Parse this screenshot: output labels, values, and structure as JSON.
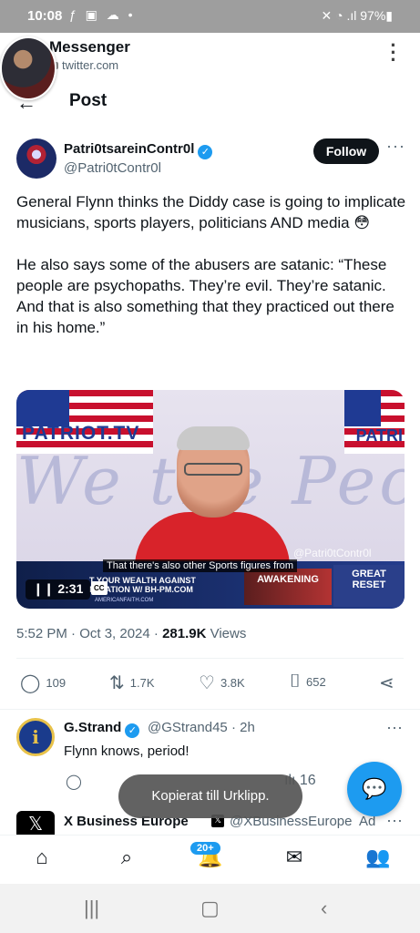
{
  "status_bar": {
    "time": "10:08",
    "left_icons": "ƒ ▣ ☁ •",
    "right": "✕ ◔ .ıl 97%▮"
  },
  "browser": {
    "title": "Messenger",
    "url": "twitter.com"
  },
  "page": {
    "back_icon": "←",
    "heading": "Post"
  },
  "tweet": {
    "author_name": "Patri0tsareinContr0l",
    "author_handle": "@Patri0tContr0l",
    "follow_label": "Follow",
    "text": "General Flynn thinks the Diddy case is going to implicate musicians, sports players, politicians AND media 😳\n\nHe also says some of the abusers are satanic: “These people are psychopaths. They’re evil. They’re satanic. And that is also something that they practiced out there in his home.”",
    "time": "5:52 PM · Oct 3, 2024 · ",
    "views_count": "281.9K",
    "views_label": " Views",
    "video": {
      "brand_left": "PATRIOT.TV",
      "brand_right": "PATRI",
      "background_script": "We the People",
      "caption": "That there's also other Sports figures from",
      "watermark": "@Patri0tContr0l",
      "ad_line1": "T YOUR WEALTH AGAINST",
      "ad_line2": "NFLATION W/ BH-PM.COM",
      "ad_line3": "AMERICANFAITH.COM",
      "awakening": "AWAKENING",
      "reset_line1": "GREAT",
      "reset_line2": "RESET",
      "duration": "2:31",
      "cc": "CC"
    },
    "actions": {
      "replies": "109",
      "reposts": "1.7K",
      "likes": "3.8K",
      "bookmarks": "652"
    }
  },
  "reply": {
    "name": "G.Strand",
    "handle": "@GStrand45 · 2h",
    "text": "Flynn knows, period!",
    "avatar_letter": "i",
    "retweets_hidden": "16"
  },
  "toast": "Kopierat till Urklipp.",
  "ad": {
    "name": "X Business Europe",
    "handle": "@XBusinessEurope",
    "label": "Ad"
  },
  "nav": {
    "notifications_badge": "20+"
  },
  "colors": {
    "accent": "#1d9bf0",
    "text": "#0f1419",
    "muted": "#536471"
  }
}
